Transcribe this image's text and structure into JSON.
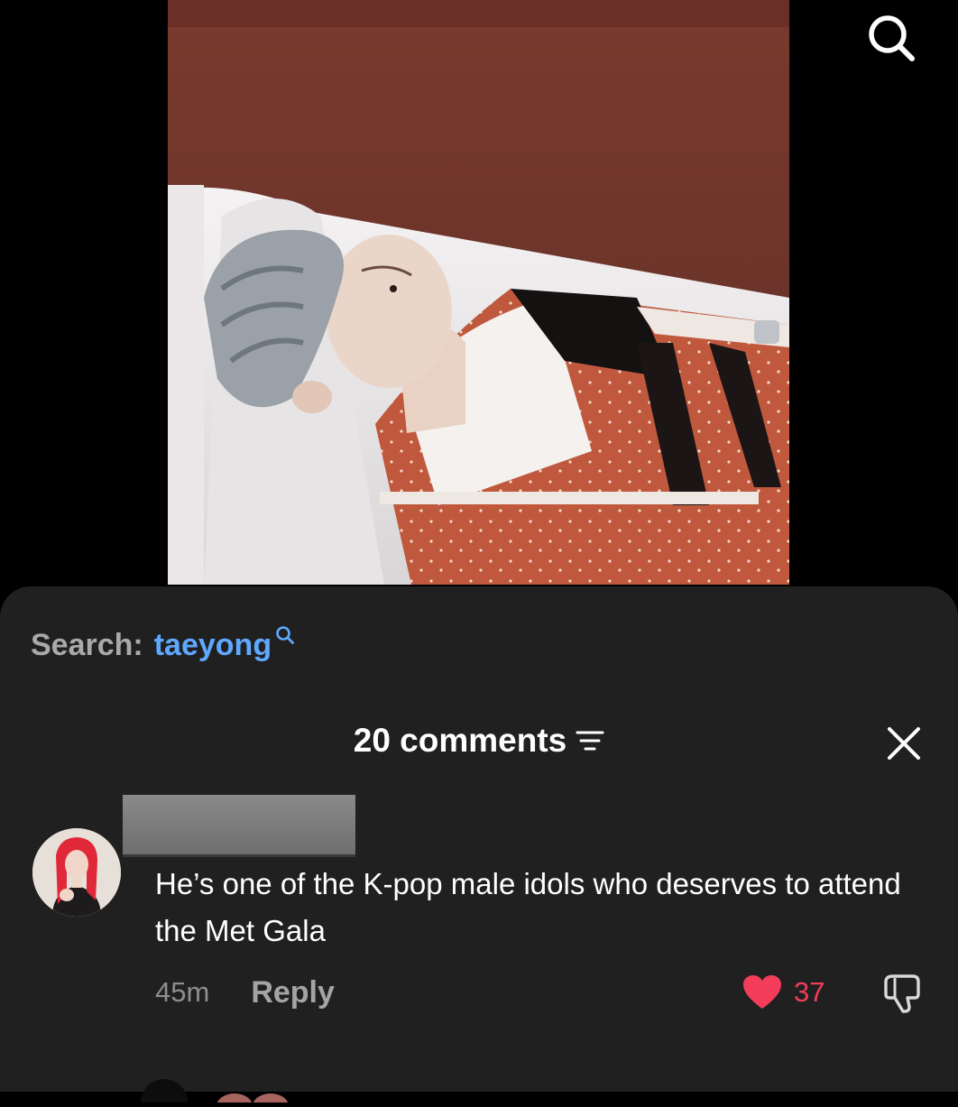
{
  "video": {
    "search_icon": "search-icon"
  },
  "search": {
    "prefix": "Search:",
    "term": "taeyong",
    "icon": "search-icon"
  },
  "comments": {
    "count_label": "20 comments",
    "filter_icon": "filter-icon",
    "close_icon": "close-icon"
  },
  "comment": {
    "text": "He’s one of the K-pop male idols who deserves to attend the Met Gala",
    "time": "45m",
    "reply_label": "Reply",
    "like_count": "37",
    "like_icon": "heart-icon",
    "dislike_icon": "thumbs-down-icon"
  },
  "colors": {
    "sheet_bg": "#202020",
    "link_blue": "#5fa8ff",
    "like_red": "#f33d5a"
  }
}
